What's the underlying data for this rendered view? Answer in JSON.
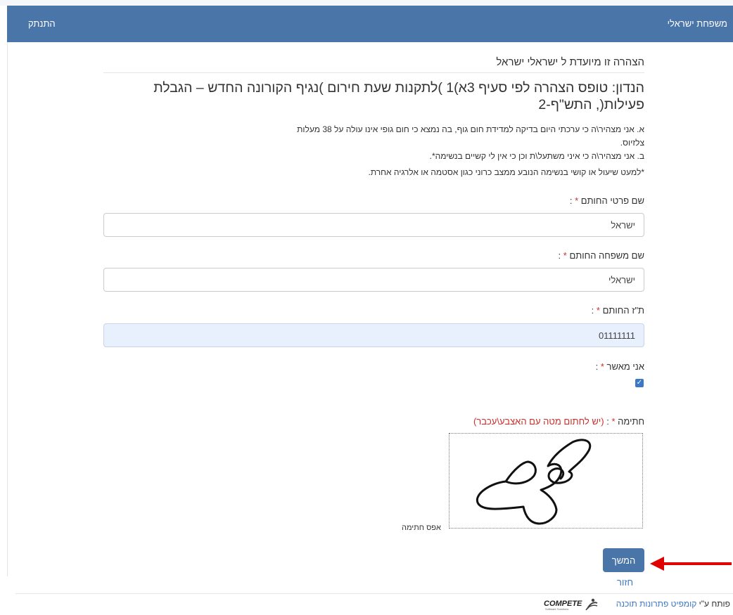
{
  "navbar": {
    "brand_user": "משפחת ישראלי",
    "logout": "התנתק"
  },
  "intro": "הצהרה זו מיועדת ל ישראלי ישראל",
  "heading": "הנדון: טופס הצהרה לפי סעיף 3א)1 )לתקנות שעת חירום )נגיף הקורונה החדש – הגבלת פעילות(, התש\"ף-2",
  "statements": {
    "a_line1": "א. אני מצהיר\\ה כי ערכתי היום בדיקה למדידת חום גוף, בה נמצא כי חום גופי אינו עולה על 38 מעלות",
    "a_line2": "צלזיוס.",
    "b": "ב. אני מצהיר\\ה כי איני משתעל\\ת וכן כי אין לי קשיים בנשימה*.",
    "note": "*למעט שיעול או קושי בנשימה הנובע ממצב כרוני כגון אסטמה או אלרגיה אחרת."
  },
  "form": {
    "first_name": {
      "label": "שם פרטי החותם",
      "value": "ישראל"
    },
    "last_name": {
      "label": "שם משפחה החותם",
      "value": "ישראלי"
    },
    "id": {
      "label": "ת\"ז החותם",
      "value": "01111111"
    },
    "approve": {
      "label": "אני מאשר",
      "checked": true
    },
    "signature": {
      "label": "חתימה",
      "hint": "(יש לחתום מטה עם האצבע\\עכבר)",
      "clear": "אפס חתימה"
    },
    "required_mark": "*",
    "colon": ":"
  },
  "buttons": {
    "continue": "המשך",
    "back": "חזור"
  },
  "footer": {
    "prefix": "פותח ע\"י",
    "company": "קומפיט פתרונות תוכנה",
    "logo_text": "COMPETE",
    "logo_sub": "Software Solutions"
  },
  "colors": {
    "navbar": "#4a75a9",
    "required": "#c9302c",
    "link": "#3b78c8",
    "arrow": "#e00000"
  }
}
